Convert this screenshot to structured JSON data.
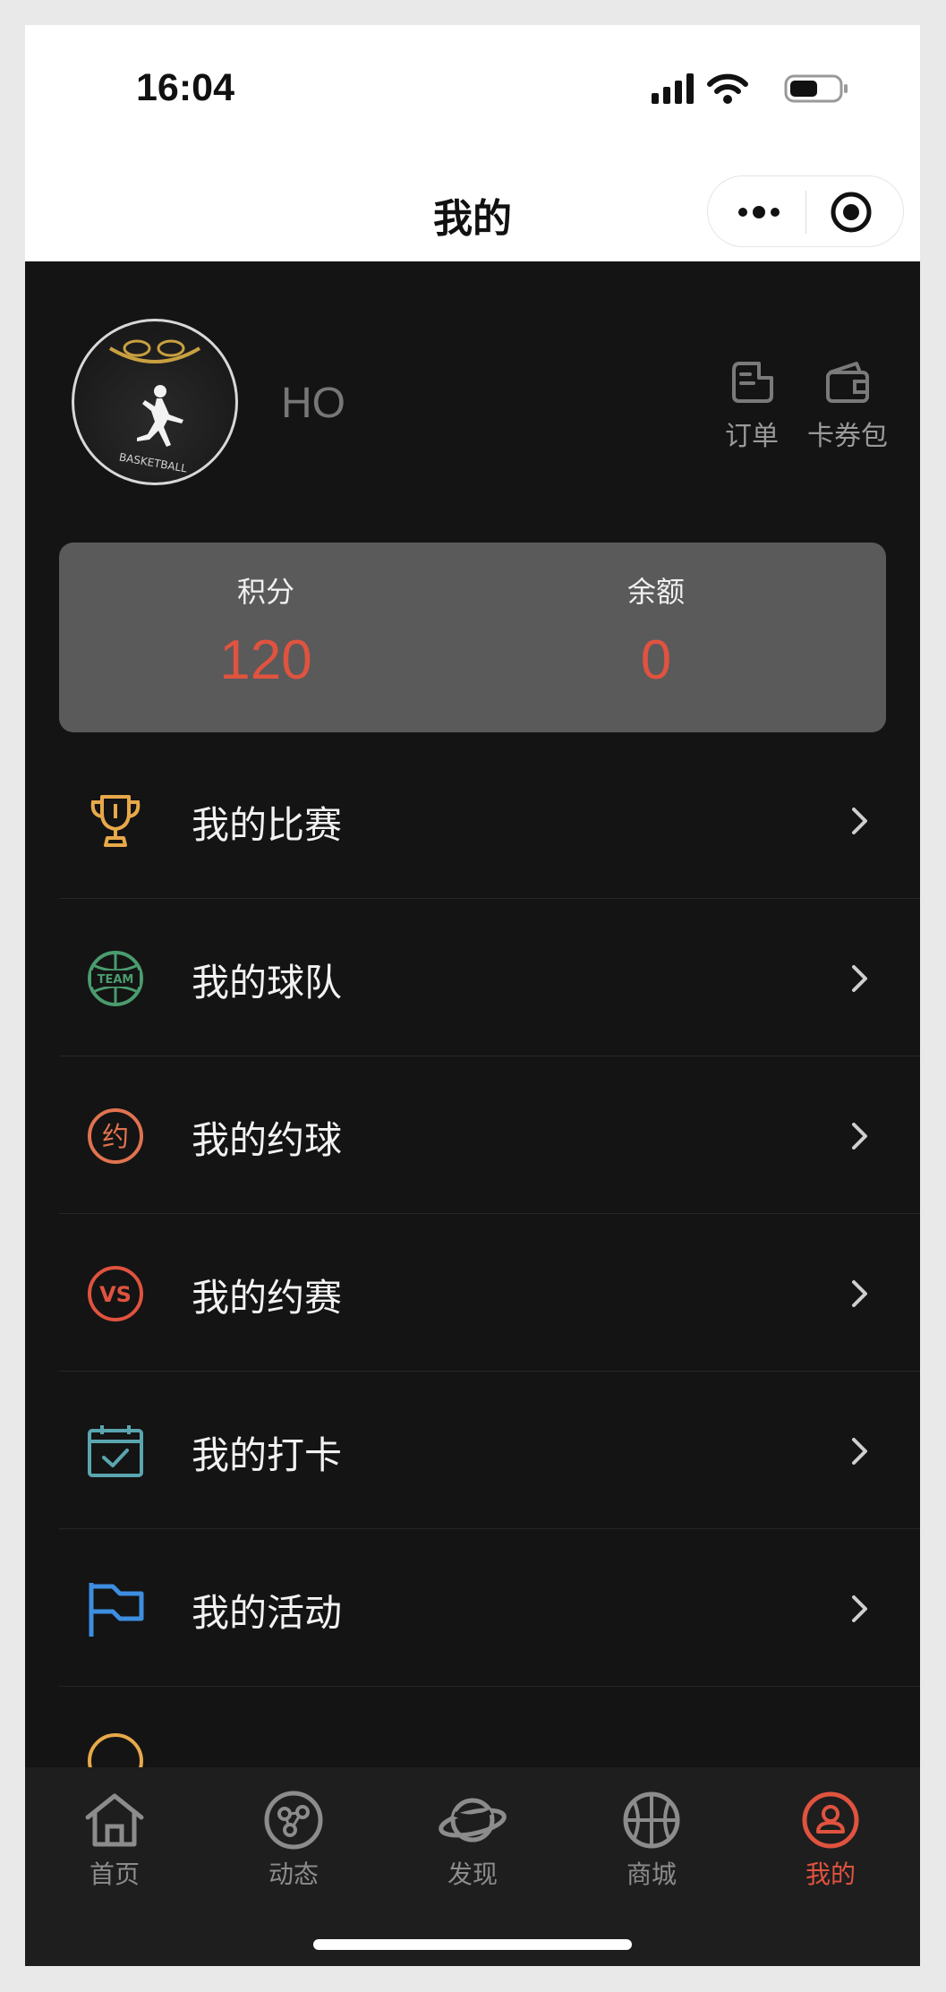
{
  "status_bar": {
    "time": "16:04"
  },
  "nav": {
    "title": "我的"
  },
  "profile": {
    "username": "HO",
    "avatar_caption": "BASKETBALL"
  },
  "quick_links": [
    {
      "label": "订单",
      "icon": "order-icon"
    },
    {
      "label": "卡券包",
      "icon": "wallet-icon"
    }
  ],
  "stats": [
    {
      "label": "积分",
      "value": "120"
    },
    {
      "label": "余额",
      "value": "0"
    }
  ],
  "menu": [
    {
      "label": "我的比赛",
      "icon": "trophy-icon",
      "color": "#e8a94a"
    },
    {
      "label": "我的球队",
      "icon": "team-ball-icon",
      "color": "#4a9c6e",
      "icon_text": "TEAM"
    },
    {
      "label": "我的约球",
      "icon": "yue-badge-icon",
      "color": "#e0734f",
      "icon_text": "约"
    },
    {
      "label": "我的约赛",
      "icon": "vs-badge-icon",
      "color": "#e0533f",
      "icon_text": "VS"
    },
    {
      "label": "我的打卡",
      "icon": "calendar-check-icon",
      "color": "#5aa6b0"
    },
    {
      "label": "我的活动",
      "icon": "flag-icon",
      "color": "#3d8ee0"
    }
  ],
  "tabs": [
    {
      "label": "首页",
      "icon": "home-icon",
      "active": false
    },
    {
      "label": "动态",
      "icon": "share-icon",
      "active": false
    },
    {
      "label": "发现",
      "icon": "planet-icon",
      "active": false
    },
    {
      "label": "商城",
      "icon": "basketball-icon",
      "active": false
    },
    {
      "label": "我的",
      "icon": "user-icon",
      "active": true
    }
  ],
  "colors": {
    "accent": "#e0533f",
    "background": "#141414",
    "card": "#5a5a5a"
  }
}
